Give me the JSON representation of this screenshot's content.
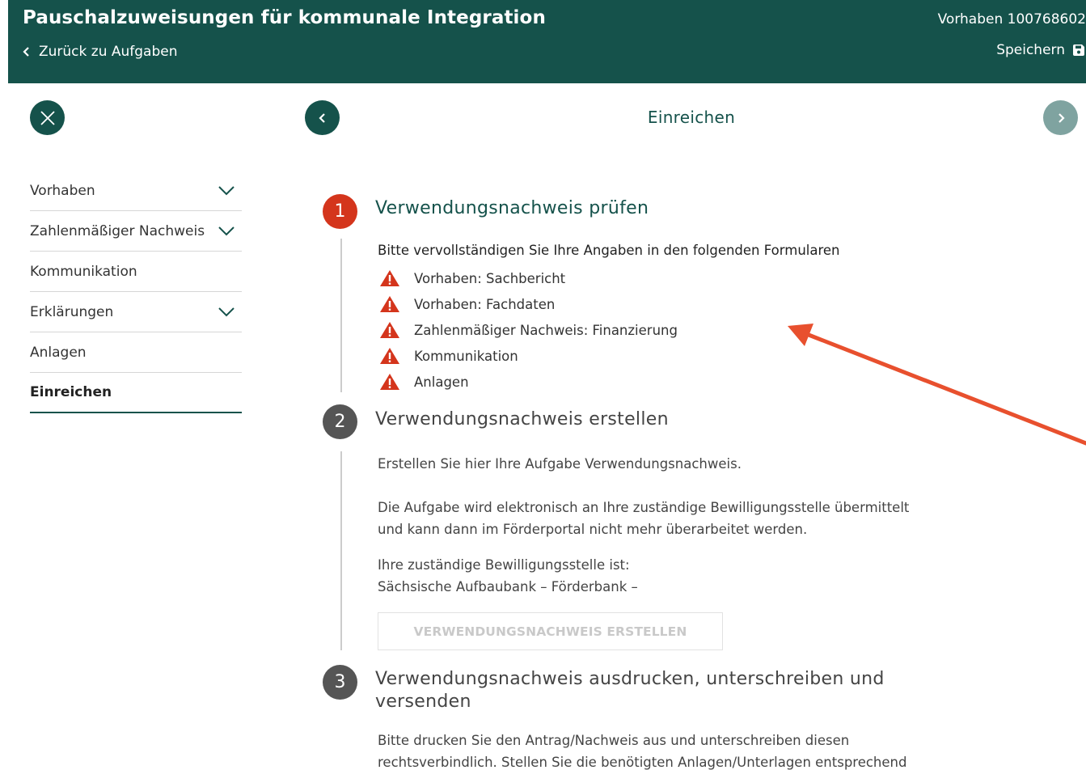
{
  "header": {
    "title": "Pauschalzuweisungen für kommunale Integration",
    "back_label": "Zurück zu Aufgaben",
    "vorhaben_label": "Vorhaben 100768602",
    "save_label": "Speichern"
  },
  "nav": {
    "page_title": "Einreichen"
  },
  "sidebar": {
    "items": [
      {
        "label": "Vorhaben",
        "expandable": true
      },
      {
        "label": "Zahlenmäßiger Nachweis",
        "expandable": true
      },
      {
        "label": "Kommunikation",
        "expandable": false
      },
      {
        "label": "Erklärungen",
        "expandable": true
      },
      {
        "label": "Anlagen",
        "expandable": false
      },
      {
        "label": "Einreichen",
        "expandable": false,
        "active": true
      }
    ]
  },
  "steps": [
    {
      "number": "1",
      "title": "Verwendungsnachweis prüfen",
      "intro": "Bitte vervollständigen Sie Ihre Angaben in den folgenden Formularen",
      "warnings": [
        "Vorhaben: Sachbericht",
        "Vorhaben: Fachdaten",
        "Zahlenmäßiger Nachweis: Finanzierung",
        "Kommunikation",
        "Anlagen"
      ]
    },
    {
      "number": "2",
      "title": "Verwendungsnachweis erstellen",
      "para1": "Erstellen Sie hier Ihre Aufgabe Verwendungsnachweis.",
      "para2_line1": "Die Aufgabe wird elektronisch an Ihre zuständige Bewilligungsstelle übermittelt",
      "para2_line2": "und kann dann im Förderportal nicht mehr überarbeitet werden.",
      "para3_line1": "Ihre zuständige Bewilligungsstelle ist:",
      "para3_line2": "Sächsische Aufbaubank – Förderbank –",
      "button_label": "VERWENDUNGSNACHWEIS ERSTELLEN"
    },
    {
      "number": "3",
      "title_line1": "Verwendungsnachweis ausdrucken, unterschreiben und",
      "title_line2": "versenden",
      "para_line1": "Bitte drucken Sie den Antrag/Nachweis aus und unterschreiben diesen",
      "para_line2": "rechtsverbindlich. Stellen Sie die benötigten Anlagen/Unterlagen entsprechend"
    }
  ],
  "colors": {
    "brand": "#15524b",
    "warning": "#d4351c",
    "annotation_arrow": "#e8502e",
    "disabled_next": "#7fa3a0"
  }
}
